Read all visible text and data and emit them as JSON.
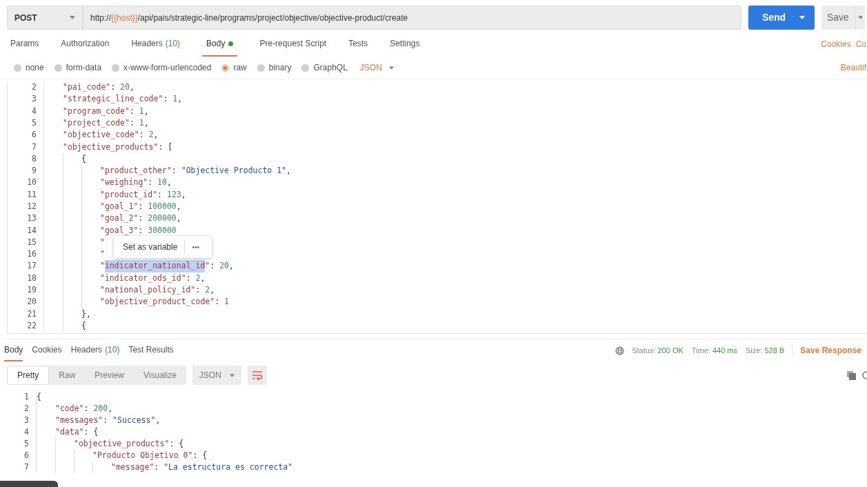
{
  "request": {
    "method": "POST",
    "url_parts": [
      {
        "kind": "plain",
        "text": "http://"
      },
      {
        "kind": "variable",
        "text": "{{host}}"
      },
      {
        "kind": "plain",
        "text": "/api/pais/strategic-line/programs/project/objective/objective-product/create"
      }
    ],
    "send": "Send",
    "save": "Save"
  },
  "request_tabs": [
    {
      "label": "Params",
      "selected": false
    },
    {
      "label": "Authorization",
      "selected": false
    },
    {
      "label": "Headers",
      "count": "(10)",
      "selected": false
    },
    {
      "label": "Body",
      "dot": true,
      "selected": true
    },
    {
      "label": "Pre-request Script",
      "selected": false
    },
    {
      "label": "Tests",
      "selected": false
    },
    {
      "label": "Settings",
      "selected": false
    }
  ],
  "request_links": [
    "Cookies",
    "Co"
  ],
  "body_types": [
    {
      "label": "none",
      "selected": false
    },
    {
      "label": "form-data",
      "selected": false
    },
    {
      "label": "x-www-form-urlencoded",
      "selected": false
    },
    {
      "label": "raw",
      "selected": true
    },
    {
      "label": "binary",
      "selected": false
    },
    {
      "label": "GraphQL",
      "selected": false
    }
  ],
  "body_format": "JSON",
  "beautify": "Beautif",
  "editor_lines": [
    {
      "number": "2",
      "tokens": [
        {
          "kind": "key",
          "text": "\"pai_code\""
        },
        {
          "kind": "punct",
          "text": ": "
        },
        {
          "kind": "number",
          "text": "20"
        },
        {
          "kind": "punct",
          "text": ","
        }
      ]
    },
    {
      "number": "3",
      "tokens": [
        {
          "kind": "key",
          "text": "\"strategic_line_code\""
        },
        {
          "kind": "punct",
          "text": ": "
        },
        {
          "kind": "number",
          "text": "1"
        },
        {
          "kind": "punct",
          "text": ","
        }
      ]
    },
    {
      "number": "4",
      "tokens": [
        {
          "kind": "key",
          "text": "\"program_code\""
        },
        {
          "kind": "punct",
          "text": ": "
        },
        {
          "kind": "number",
          "text": "1"
        },
        {
          "kind": "punct",
          "text": ","
        }
      ]
    },
    {
      "number": "5",
      "tokens": [
        {
          "kind": "key",
          "text": "\"project_code\""
        },
        {
          "kind": "punct",
          "text": ": "
        },
        {
          "kind": "number",
          "text": "1"
        },
        {
          "kind": "punct",
          "text": ","
        }
      ]
    },
    {
      "number": "6",
      "tokens": [
        {
          "kind": "key",
          "text": "\"objective_code\""
        },
        {
          "kind": "punct",
          "text": ": "
        },
        {
          "kind": "number",
          "text": "2"
        },
        {
          "kind": "punct",
          "text": ","
        }
      ]
    },
    {
      "number": "7",
      "tokens": [
        {
          "kind": "key",
          "text": "\"objective_products\""
        },
        {
          "kind": "punct",
          "text": ": ["
        }
      ],
      "children": [
        {
          "number": "8",
          "tokens": [
            {
              "kind": "punct",
              "text": "{"
            }
          ],
          "children": [
            {
              "number": "9",
              "tokens": [
                {
                  "kind": "key",
                  "text": "\"product_other\""
                },
                {
                  "kind": "punct",
                  "text": ": "
                },
                {
                  "kind": "string",
                  "text": "\"Objective Producto 1\""
                },
                {
                  "kind": "punct",
                  "text": ","
                }
              ]
            },
            {
              "number": "10",
              "tokens": [
                {
                  "kind": "key",
                  "text": "\"weighing\""
                },
                {
                  "kind": "punct",
                  "text": ": "
                },
                {
                  "kind": "number",
                  "text": "10"
                },
                {
                  "kind": "punct",
                  "text": ","
                }
              ]
            },
            {
              "number": "11",
              "tokens": [
                {
                  "kind": "key",
                  "text": "\"product_id\""
                },
                {
                  "kind": "punct",
                  "text": ": "
                },
                {
                  "kind": "number",
                  "text": "123"
                },
                {
                  "kind": "punct",
                  "text": ","
                }
              ]
            },
            {
              "number": "12",
              "tokens": [
                {
                  "kind": "key",
                  "text": "\"goal_1\""
                },
                {
                  "kind": "punct",
                  "text": ": "
                },
                {
                  "kind": "number",
                  "text": "100000"
                },
                {
                  "kind": "punct",
                  "text": ","
                }
              ]
            },
            {
              "number": "13",
              "tokens": [
                {
                  "kind": "key",
                  "text": "\"goal_2\""
                },
                {
                  "kind": "punct",
                  "text": ": "
                },
                {
                  "kind": "number",
                  "text": "200000"
                },
                {
                  "kind": "punct",
                  "text": ","
                }
              ]
            },
            {
              "number": "14",
              "tokens": [
                {
                  "kind": "key",
                  "text": "\"goal_3\""
                },
                {
                  "kind": "punct",
                  "text": ": "
                },
                {
                  "kind": "number",
                  "text": "300000"
                }
              ]
            },
            {
              "number": "15",
              "tokens": [
                {
                  "kind": "key",
                  "text": "\""
                }
              ]
            },
            {
              "number": "16",
              "tokens": [
                {
                  "kind": "key",
                  "text": "\""
                }
              ]
            },
            {
              "number": "17",
              "tokens": [
                {
                  "kind": "key",
                  "text": "\""
                },
                {
                  "kind": "key",
                  "text": "indicator_national_id",
                  "selected": true
                },
                {
                  "kind": "key",
                  "text": "\""
                },
                {
                  "kind": "punct",
                  "text": ": "
                },
                {
                  "kind": "number",
                  "text": "20"
                },
                {
                  "kind": "punct",
                  "text": ","
                }
              ]
            },
            {
              "number": "18",
              "tokens": [
                {
                  "kind": "key",
                  "text": "\"indicator_ods_id\""
                },
                {
                  "kind": "punct",
                  "text": ": "
                },
                {
                  "kind": "number",
                  "text": "2"
                },
                {
                  "kind": "punct",
                  "text": ","
                }
              ]
            },
            {
              "number": "19",
              "tokens": [
                {
                  "kind": "key",
                  "text": "\"national_policy_id\""
                },
                {
                  "kind": "punct",
                  "text": ": "
                },
                {
                  "kind": "number",
                  "text": "2"
                },
                {
                  "kind": "punct",
                  "text": ","
                }
              ]
            },
            {
              "number": "20",
              "tokens": [
                {
                  "kind": "key",
                  "text": "\"objective_product_code\""
                },
                {
                  "kind": "punct",
                  "text": ": "
                },
                {
                  "kind": "number",
                  "text": "1"
                }
              ]
            }
          ]
        },
        {
          "number": "21",
          "tokens": [
            {
              "kind": "punct",
              "text": "},"
            }
          ]
        },
        {
          "number": "22",
          "tokens": [
            {
              "kind": "punct",
              "text": "{"
            }
          ]
        }
      ]
    }
  ],
  "context_menu": {
    "action": "Set as variable",
    "more": "•••"
  },
  "response_tabs": [
    {
      "label": "Body",
      "selected": true
    },
    {
      "label": "Cookies",
      "selected": false
    },
    {
      "label": "Headers",
      "count": "(10)",
      "selected": false
    },
    {
      "label": "Test Results",
      "selected": false
    }
  ],
  "response_meta": [
    {
      "label": "Status:",
      "value": "200 OK"
    },
    {
      "label": "Time:",
      "value": "440 ms"
    },
    {
      "label": "Size:",
      "value": "528 B"
    }
  ],
  "save_response": "Save Response",
  "view_modes": [
    {
      "label": "Pretty",
      "selected": true
    },
    {
      "label": "Raw",
      "selected": false
    },
    {
      "label": "Preview",
      "selected": false
    },
    {
      "label": "Visualize",
      "selected": false
    }
  ],
  "response_format": "JSON",
  "response_lines": [
    {
      "number": "1",
      "tokens": [
        {
          "kind": "punct",
          "text": "{"
        }
      ],
      "children": [
        {
          "number": "2",
          "tokens": [
            {
              "kind": "key",
              "text": "\"code\""
            },
            {
              "kind": "punct",
              "text": ": "
            },
            {
              "kind": "number",
              "text": "200"
            },
            {
              "kind": "punct",
              "text": ","
            }
          ]
        },
        {
          "number": "3",
          "tokens": [
            {
              "kind": "key",
              "text": "\"messages\""
            },
            {
              "kind": "punct",
              "text": ": "
            },
            {
              "kind": "string",
              "text": "\"Success\""
            },
            {
              "kind": "punct",
              "text": ","
            }
          ]
        },
        {
          "number": "4",
          "tokens": [
            {
              "kind": "key",
              "text": "\"data\""
            },
            {
              "kind": "punct",
              "text": ": {"
            }
          ],
          "children": [
            {
              "number": "5",
              "tokens": [
                {
                  "kind": "key",
                  "text": "\"objective_products\""
                },
                {
                  "kind": "punct",
                  "text": ": {"
                }
              ],
              "children": [
                {
                  "number": "6",
                  "tokens": [
                    {
                      "kind": "key",
                      "text": "\"Producto Objetivo 0\""
                    },
                    {
                      "kind": "punct",
                      "text": ": {"
                    }
                  ],
                  "children": [
                    {
                      "number": "7",
                      "tokens": [
                        {
                          "kind": "key",
                          "text": "\"message\""
                        },
                        {
                          "kind": "punct",
                          "text": ": "
                        },
                        {
                          "kind": "string",
                          "text": "\"La estructura es correcta\""
                        }
                      ]
                    }
                  ]
                }
              ]
            }
          ]
        }
      ]
    }
  ]
}
